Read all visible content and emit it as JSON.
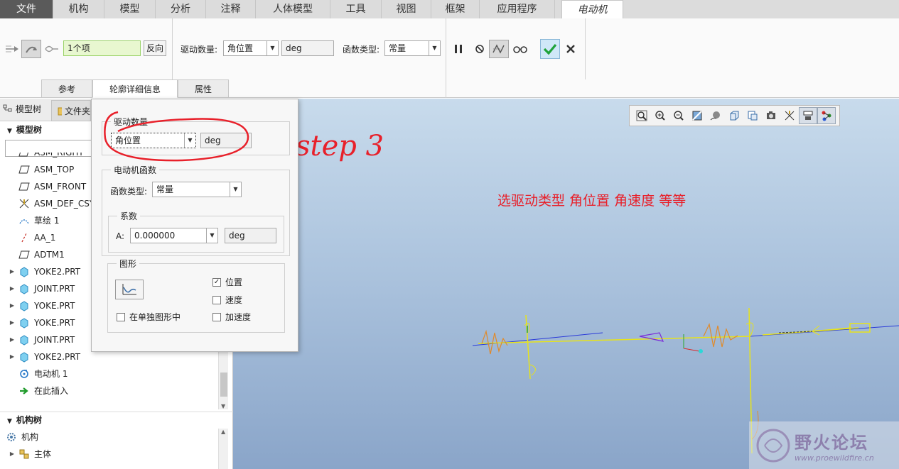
{
  "menu": {
    "tabs": [
      "文件",
      "机构",
      "模型",
      "分析",
      "注释",
      "人体模型",
      "工具",
      "视图",
      "框架",
      "应用程序",
      "电动机"
    ],
    "active_index": 10
  },
  "ribbon": {
    "reference_value": "1个项",
    "flip_button": "反向",
    "drive_quantity_label": "驱动数量:",
    "drive_quantity_value": "角位置",
    "unit": "deg",
    "function_type_label": "函数类型:",
    "function_type_value": "常量",
    "tabs": [
      "参考",
      "轮廓详细信息",
      "属性"
    ],
    "active_tab_index": 1
  },
  "left_panel": {
    "tab_model_tree": "模型树",
    "tab_folder": "文件夹",
    "model_tree_header": "模型树",
    "items": [
      {
        "label": "ASM_RIGHT",
        "icon": "datum-plane-icon",
        "expandable": false
      },
      {
        "label": "ASM_TOP",
        "icon": "datum-plane-icon",
        "expandable": false
      },
      {
        "label": "ASM_FRONT",
        "icon": "datum-plane-icon",
        "expandable": false
      },
      {
        "label": "ASM_DEF_CSYS",
        "icon": "csys-icon",
        "expandable": false
      },
      {
        "label": "草绘 1",
        "icon": "sketch-icon",
        "expandable": false
      },
      {
        "label": "AA_1",
        "icon": "axis-icon",
        "expandable": false
      },
      {
        "label": "ADTM1",
        "icon": "datum-plane-icon",
        "expandable": false
      },
      {
        "label": "YOKE2.PRT",
        "icon": "part-icon",
        "expandable": true
      },
      {
        "label": "JOINT.PRT",
        "icon": "part-icon",
        "expandable": true
      },
      {
        "label": "YOKE.PRT",
        "icon": "part-icon",
        "expandable": true
      },
      {
        "label": "YOKE.PRT",
        "icon": "part-icon",
        "expandable": true
      },
      {
        "label": "JOINT.PRT",
        "icon": "part-icon",
        "expandable": true
      },
      {
        "label": "YOKE2.PRT",
        "icon": "part-icon",
        "expandable": true
      },
      {
        "label": "电动机 1",
        "icon": "motor-icon",
        "expandable": false
      },
      {
        "label": "在此插入",
        "icon": "insert-arrow-icon",
        "expandable": false
      }
    ],
    "mechanism_tree_header": "机构树",
    "mech_items": [
      "机构",
      "主体"
    ]
  },
  "popup": {
    "group_drive": "驱动数量",
    "drive_value": "角位置",
    "drive_unit": "deg",
    "group_function": "电动机函数",
    "function_type_label": "函数类型:",
    "function_type_value": "常量",
    "group_coeff": "系数",
    "coeff_label": "A:",
    "coeff_value": "0.000000",
    "coeff_unit": "deg",
    "group_graph": "图形",
    "separate_graph_label": "在单独图形中",
    "position_label": "位置",
    "velocity_label": "速度",
    "acceleration_label": "加速度",
    "position_checked": true
  },
  "annotations": {
    "step": "step 3",
    "note": "选驱动类型 角位置 角速度 等等"
  },
  "watermark": {
    "title": "野火论坛",
    "url": "www.proewildfire.cn"
  },
  "colors": {
    "accent_red": "#e8202a",
    "confirm_green": "#1fa33a",
    "tree_icon": "#3aa6d8"
  }
}
